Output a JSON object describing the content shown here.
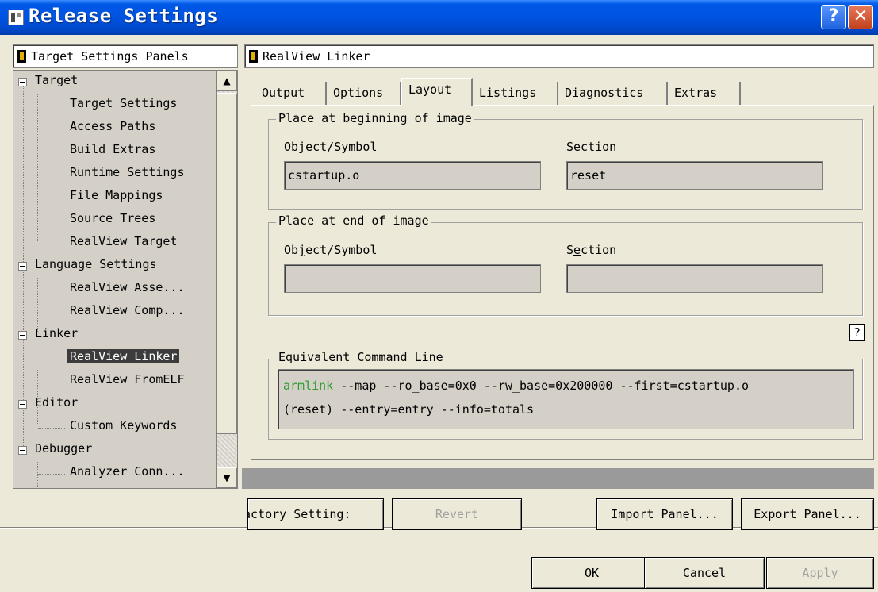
{
  "window": {
    "title": "Release Settings",
    "help_glyph": "?",
    "close_glyph": "✕"
  },
  "left_panel": {
    "header": "Target Settings Panels",
    "tree": [
      {
        "label": "Target",
        "level": 0,
        "expanded": true
      },
      {
        "label": "Target Settings",
        "level": 1
      },
      {
        "label": "Access Paths",
        "level": 1
      },
      {
        "label": "Build Extras",
        "level": 1
      },
      {
        "label": "Runtime Settings",
        "level": 1
      },
      {
        "label": "File Mappings",
        "level": 1
      },
      {
        "label": "Source Trees",
        "level": 1
      },
      {
        "label": "RealView Target",
        "level": 1
      },
      {
        "label": "Language Settings",
        "level": 0,
        "expanded": true
      },
      {
        "label": "RealView Asse...",
        "level": 1
      },
      {
        "label": "RealView Comp...",
        "level": 1
      },
      {
        "label": "Linker",
        "level": 0,
        "expanded": true
      },
      {
        "label": "RealView Linker",
        "level": 1,
        "selected": true
      },
      {
        "label": "RealView FromELF",
        "level": 1
      },
      {
        "label": "Editor",
        "level": 0,
        "expanded": true
      },
      {
        "label": "Custom Keywords",
        "level": 1
      },
      {
        "label": "Debugger",
        "level": 0,
        "expanded": true
      },
      {
        "label": "Analyzer Conn...",
        "level": 1
      }
    ],
    "scroll_up": "▲",
    "scroll_down": "▼"
  },
  "right_panel": {
    "header": "RealView Linker",
    "tabs": [
      "Output",
      "Options",
      "Layout",
      "Listings",
      "Diagnostics",
      "Extras"
    ],
    "active_tab": "Layout",
    "begin_group": {
      "title": "Place at beginning of image",
      "object_label": "Object/Symbol",
      "section_label": "Section",
      "object_value": "cstartup.o",
      "section_value": "reset"
    },
    "end_group": {
      "title": "Place at end of image",
      "object_label": "Object/Symbol",
      "section_label": "Section",
      "object_value": "",
      "section_value": ""
    },
    "help_button": "?",
    "command_line": {
      "title": "Equivalent Command Line",
      "keyword": "armlink",
      "line1_rest": " --map --ro_base=0x0 --rw_base=0x200000 --first=cstartup.o",
      "line2": "(reset) --entry=entry --info=totals"
    }
  },
  "panel_buttons": {
    "factory_settings": "actory Setting:",
    "revert": "Revert",
    "import_panel": "Import Panel...",
    "export_panel": "Export Panel..."
  },
  "dialog_buttons": {
    "ok": "OK",
    "cancel": "Cancel",
    "apply": "Apply"
  }
}
